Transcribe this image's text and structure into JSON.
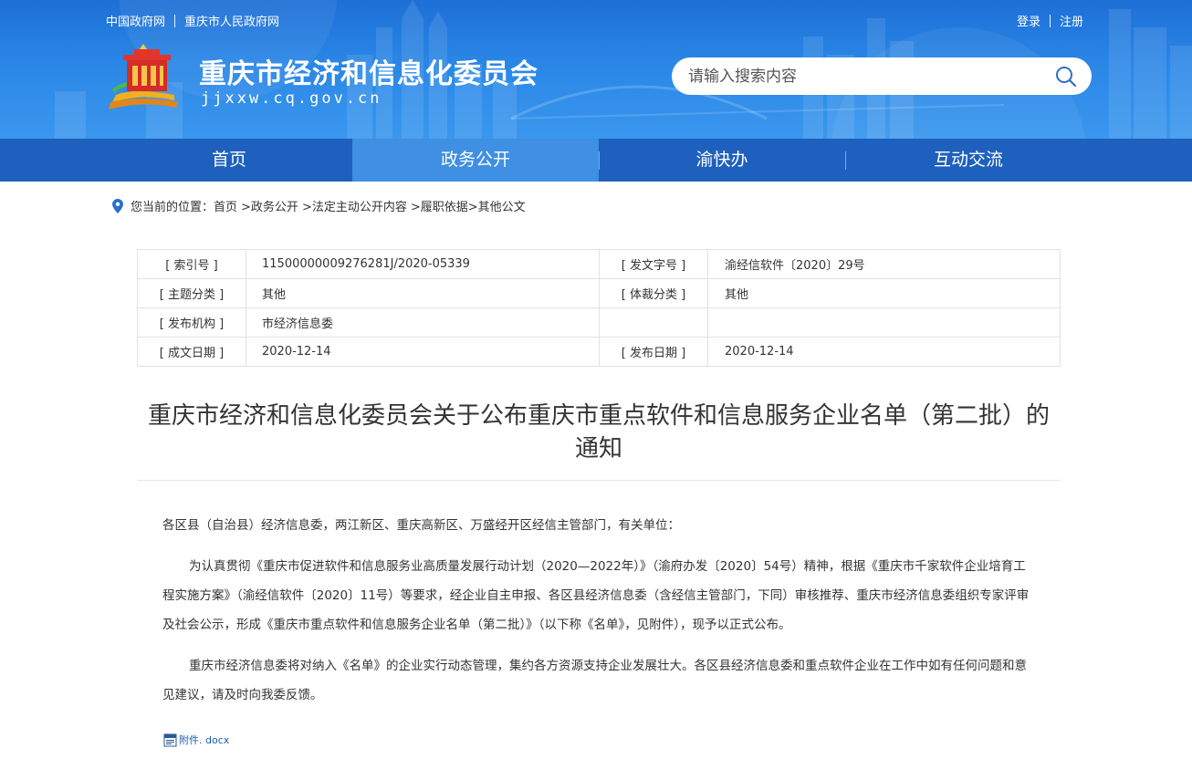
{
  "top_links": [
    "中国政府网",
    "重庆市人民政府网"
  ],
  "user_links": [
    "登录",
    "注册"
  ],
  "site": {
    "name": "重庆市经济和信息化委员会",
    "domain": "jjxxw.cq.gov.cn"
  },
  "search": {
    "placeholder": "请输入搜索内容",
    "icon": "search-icon"
  },
  "nav": {
    "items": [
      "首页",
      "政务公开",
      "渝快办",
      "互动交流"
    ],
    "active": "政务公开"
  },
  "breadcrumb": {
    "prefix": "您当前的位置：",
    "items": [
      "首页",
      ">政务公开",
      ">法定主动公开内容",
      ">履职依据",
      ">其他公文"
    ]
  },
  "meta": {
    "rows": [
      {
        "k1": "[ 索引号 ]",
        "v1": "11500000009276281J/2020-05339",
        "k2": "[ 发文字号 ]",
        "v2": "渝经信软件〔2020〕29号"
      },
      {
        "k1": "[ 主题分类 ]",
        "v1": "其他",
        "k2": "[ 体裁分类 ]",
        "v2": "其他"
      },
      {
        "k1": "[ 发布机构 ]",
        "v1": "市经济信息委",
        "k2": "",
        "v2": ""
      },
      {
        "k1": "[ 成文日期 ]",
        "v1": "2020-12-14",
        "k2": "[ 发布日期 ]",
        "v2": "2020-12-14"
      }
    ]
  },
  "document": {
    "title_line1": "重庆市经济和信息化委员会关于公布重庆市重点软件和信息服务企业名单（第二批）的",
    "title_line2": "通知",
    "salutation": "各区县（自治县）经济信息委，两江新区、重庆高新区、万盛经开区经信主管部门，有关单位：",
    "paragraphs": [
      "为认真贯彻《重庆市促进软件和信息服务业高质量发展行动计划（2020—2022年）》（渝府办发〔2020〕54号）精神，根据《重庆市千家软件企业培育工程实施方案》（渝经信软件〔2020〕11号）等要求，经企业自主申报、各区县经济信息委（含经信主管部门，下同）审核推荐、重庆市经济信息委组织专家评审及社会公示，形成《重庆市重点软件和信息服务企业名单（第二批）》（以下称《名单》，见附件），现予以正式公布。",
      "重庆市经济信息委将对纳入《名单》的企业实行动态管理，集约各方资源支持企业发展壮大。各区县经济信息委和重点软件企业在工作中如有任何问题和意见建议，请及时向我委反馈。"
    ],
    "attachment": "附件. docx"
  },
  "colors": {
    "header_blue": "#2a86e6",
    "nav_blue": "#1e60bd",
    "nav_active": "#3f8fe3",
    "link_blue": "#1a5bb5"
  }
}
